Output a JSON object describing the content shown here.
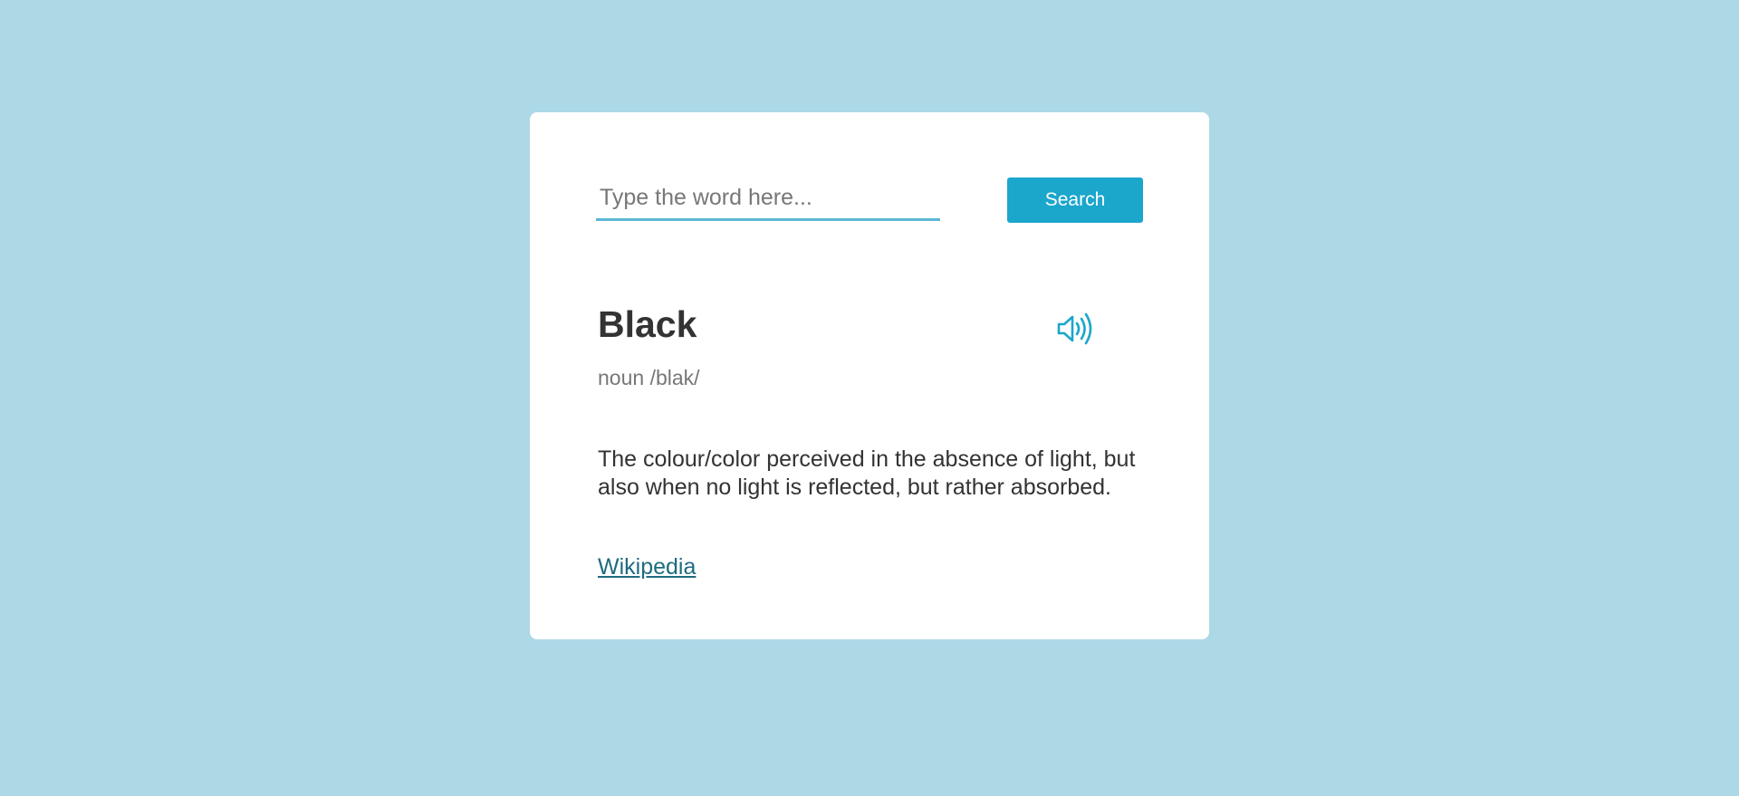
{
  "search": {
    "placeholder": "Type the word here...",
    "value": "",
    "button_label": "Search"
  },
  "result": {
    "word": "Black",
    "part_of_speech": "noun",
    "phonetic": "/blak/",
    "definition": "The colour/color perceived in the absence of light, but also when no light is reflected, but rather absorbed.",
    "source_label": "Wikipedia",
    "audio_icon": "speaker-volume-icon"
  },
  "colors": {
    "background": "#add8e6",
    "card": "#ffffff",
    "accent": "#1ba6cc",
    "input_underline": "#5bb8d4",
    "link": "#1e6b80",
    "text": "#333333",
    "muted": "#777777"
  }
}
